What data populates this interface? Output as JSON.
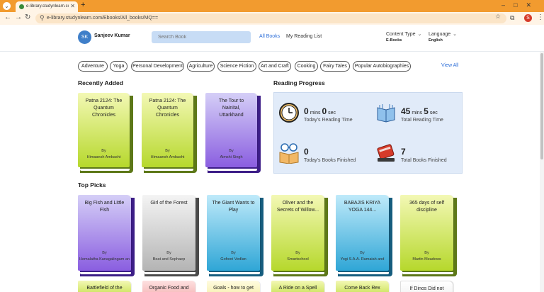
{
  "browser": {
    "tab_title": "e-library.studynlearn.com/Ebo...",
    "url": "e-library.studynlearn.com/Ebooks/All_books/MQ==",
    "profile_initial": "S"
  },
  "header": {
    "avatar_initials": "SK",
    "user_name": "Sanjeev Kumar",
    "search_placeholder": "Search Book",
    "nav": [
      "All Books",
      "My Reading List"
    ],
    "content_type_label": "Content Type",
    "content_type_value": "E-Books",
    "language_label": "Language",
    "language_value": "English"
  },
  "categories": [
    "Adventure",
    "Yoga",
    "Personal Development",
    "Agriculture",
    "Science Fiction",
    "Art and Craft",
    "Cooking",
    "Fairy Tales",
    "Popular Autobiographies"
  ],
  "view_all_label": "View All",
  "sections": {
    "recently_added": "Recently Added",
    "reading_progress": "Reading Progress",
    "top_picks": "Top Picks"
  },
  "recently_added": [
    {
      "title": "Patna 2124: The Quantum Chronicles",
      "by": "By",
      "author": "Himaansh Ambasht",
      "color": "green"
    },
    {
      "title": "Patna 2124: The Quantum Chronicles",
      "by": "By",
      "author": "Himaansh Ambasht",
      "color": "green"
    },
    {
      "title": "The Tour to Nainital, Uttarkhand",
      "by": "By",
      "author": "Aimshi Singh",
      "color": "purple"
    }
  ],
  "progress": {
    "reading_time": {
      "mins": "0",
      "mins_unit": "mins",
      "secs": "0",
      "secs_unit": "sec",
      "label": "Today's Reading Time"
    },
    "total_time": {
      "mins": "45",
      "mins_unit": "mins",
      "secs": "5",
      "secs_unit": "sec",
      "label": "Total Reading Time"
    },
    "books_today": {
      "value": "0",
      "label": "Today's Books Finished"
    },
    "books_total": {
      "value": "7",
      "label": "Total Books Finished"
    }
  },
  "top_picks": [
    {
      "title": "Big Fish and Little Fish",
      "by": "By",
      "author": "Hemalatha Kanagalingam and",
      "color": "purple"
    },
    {
      "title": "Girl of the Forest",
      "by": "By",
      "author": "Beat and Sophaep",
      "color": "gray"
    },
    {
      "title": "The Giant Wants to Play",
      "by": "By",
      "author": "Gofoori Vedlan",
      "color": "blue"
    },
    {
      "title": "Oliver and the Secrets of Willow...",
      "by": "By",
      "author": "Smartschool",
      "color": "green"
    },
    {
      "title": "BABAJIS KRIYA YOGA 144...",
      "by": "By",
      "author": "Yogi S.A.A. Ramaiah and",
      "color": "blue"
    },
    {
      "title": "365 days of self discipline",
      "by": "By",
      "author": "Martin Meadows",
      "color": "green"
    }
  ],
  "more_books": [
    {
      "title": "Battlefield of the mind",
      "color": "green"
    },
    {
      "title": "Organic Food and",
      "color": "pink"
    },
    {
      "title": "Goals - how to get",
      "color": "yellow"
    },
    {
      "title": "A Ride on a Spell",
      "color": "green"
    },
    {
      "title": "Come Back Rex",
      "color": "green"
    },
    {
      "title": "If Dinos Did not Die...",
      "color": "white"
    }
  ]
}
